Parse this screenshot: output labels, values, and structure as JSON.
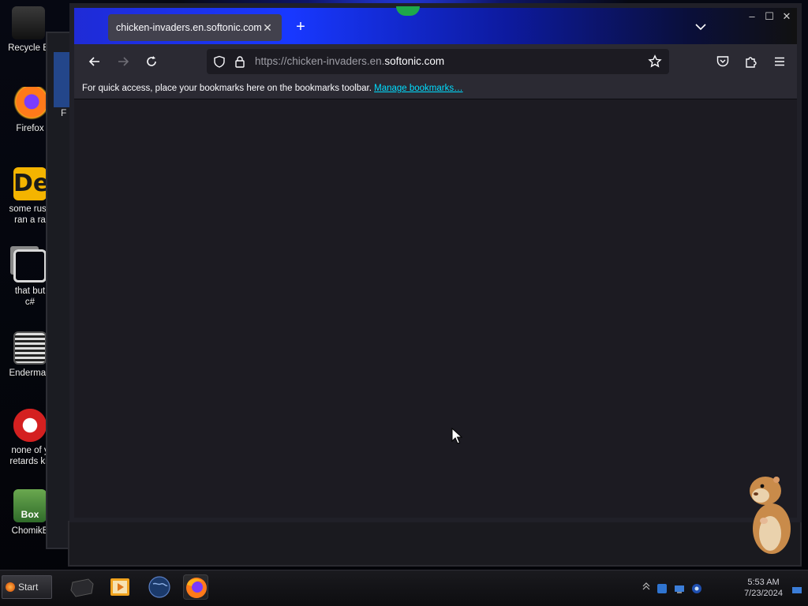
{
  "desktop": {
    "icons": [
      {
        "label_1": "Recycle B",
        "label_2": "",
        "icon": "recycle-bin-icon"
      },
      {
        "label_1": "Firefox",
        "label_2": "",
        "icon": "firefox-icon"
      },
      {
        "label_1": "some russ",
        "label_2": "ran a ra",
        "icon": "de-app-icon"
      },
      {
        "label_1": "that but",
        "label_2": "c#",
        "icon": "copy-icon"
      },
      {
        "label_1": "Enderman",
        "label_2": "",
        "icon": "enderman-icon"
      },
      {
        "label_1": "none of y",
        "label_2": "retards kn",
        "icon": "red-creature-icon"
      },
      {
        "label_1": "ChomikB",
        "label_2": "",
        "icon": "hamster-box-icon"
      }
    ],
    "box_text": "Box",
    "background_window_letter": "F"
  },
  "browser": {
    "tab": {
      "title": "chicken-invaders.en.softonic.com/",
      "close": "✕"
    },
    "new_tab": "+",
    "window_controls": {
      "minimize": "–",
      "maximize": "☐",
      "close": "✕"
    },
    "url": {
      "prefix": "https://chicken-invaders.en.",
      "host": "softonic.com"
    },
    "bookmarks_bar": {
      "message": "For quick access, place your bookmarks here on the bookmarks toolbar.",
      "link": "Manage bookmarks…"
    }
  },
  "taskbar": {
    "start_label": "Start",
    "clock_time": "5:53 AM",
    "clock_date": "7/23/2024"
  },
  "colors": {
    "tab_gradient_start": "#1f2bd6",
    "link": "#00ddff",
    "content_bg": "#1c1b22"
  }
}
